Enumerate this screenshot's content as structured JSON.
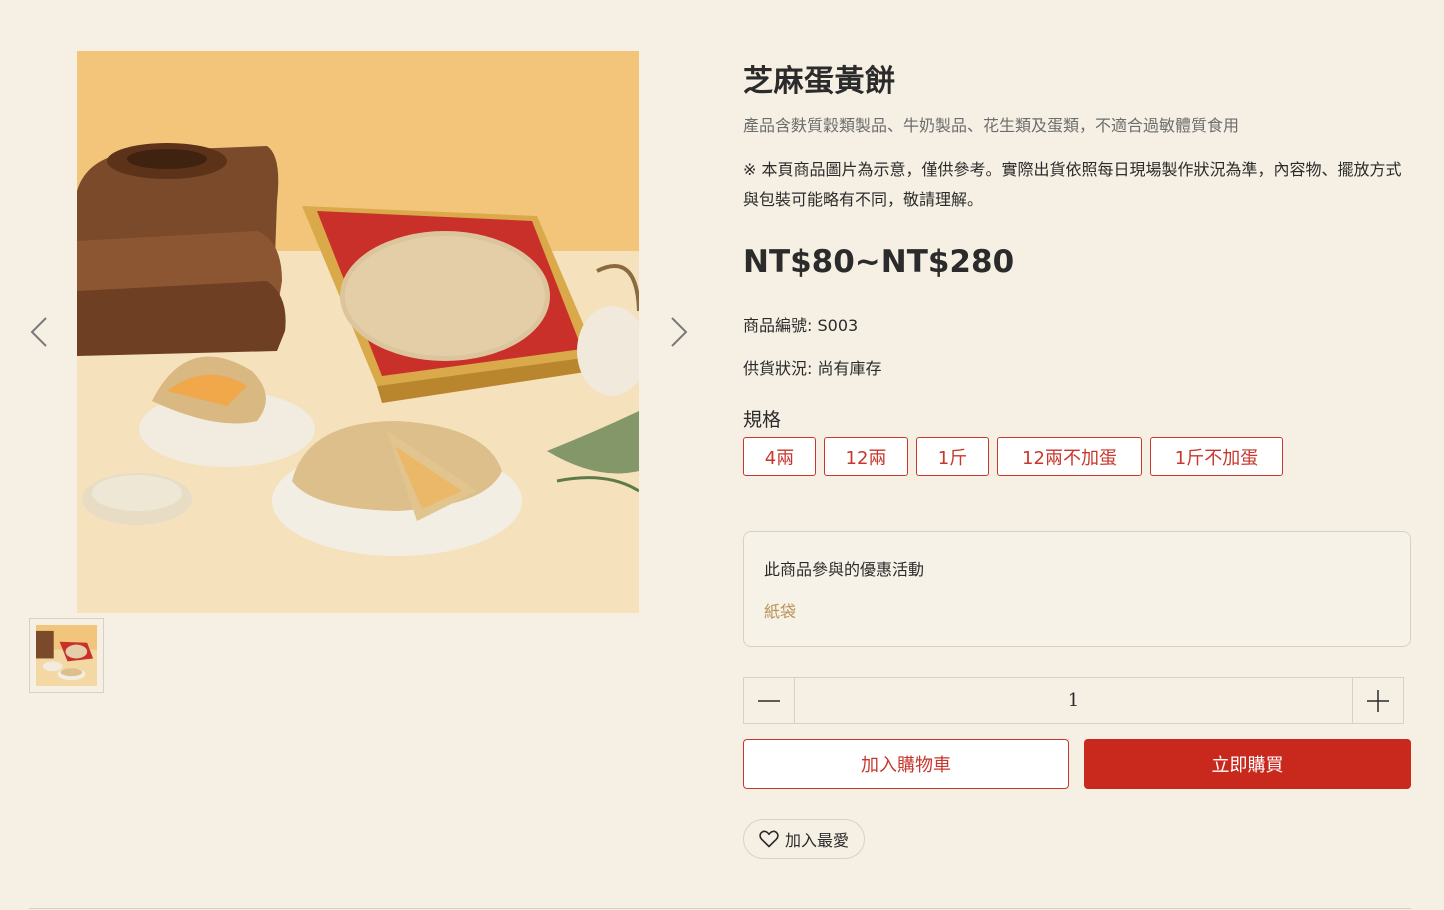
{
  "product": {
    "title": "芝麻蛋黃餅",
    "allergen_note": "產品含麩質穀類製品、牛奶製品、花生類及蛋類，不適合過敏體質食用",
    "notice": "※ 本頁商品圖片為示意，僅供參考。實際出貨依照每日現場製作狀況為準，內容物、擺放方式與包裝可能略有不同，敬請理解。",
    "price": "NT$80~NT$280",
    "sku_text": "商品編號: S003",
    "stock_text": "供貨狀況: 尚有庫存"
  },
  "spec": {
    "label": "規格",
    "options": [
      "4兩",
      "12兩",
      "1斤",
      "12兩不加蛋",
      "1斤不加蛋"
    ]
  },
  "promo": {
    "heading": "此商品參與的優惠活動",
    "item": "紙袋"
  },
  "quantity": {
    "value": "1"
  },
  "actions": {
    "add_to_cart": "加入購物車",
    "buy_now": "立即購買",
    "favorite": "加入最愛"
  },
  "gallery": {
    "prev_icon": "chevron-left-icon",
    "next_icon": "chevron-right-icon",
    "favorite_icon": "heart-icon"
  },
  "colors": {
    "background": "#f6f0e4",
    "accent": "#c9291d",
    "promo_item": "#b8935a"
  }
}
